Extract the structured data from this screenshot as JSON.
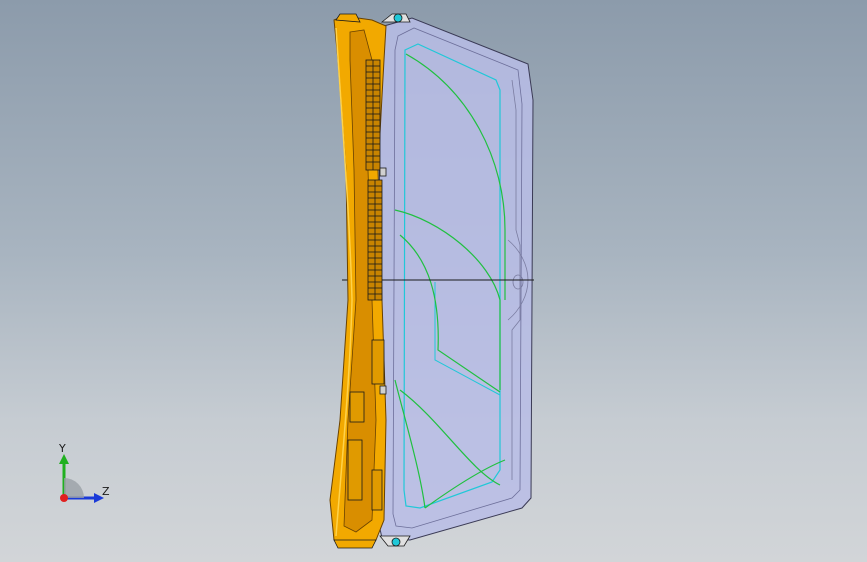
{
  "viewport": {
    "background_top": "#8c9bab",
    "background_bottom": "#d2d5d8"
  },
  "model": {
    "frame_color": "#f2a900",
    "frame_shadow_color": "#b87400",
    "glass_color": "#b8bde6",
    "inner_curve_color": "#20c040",
    "inner_panel_color": "#20c8d8",
    "edge_color": "#1a1a1a"
  },
  "triad": {
    "y_label": "Y",
    "z_label": "Z",
    "y_color": "#20b020",
    "z_color": "#1a3ad8",
    "origin_color": "#e02020",
    "sphere_color": "#9aa0a6"
  }
}
